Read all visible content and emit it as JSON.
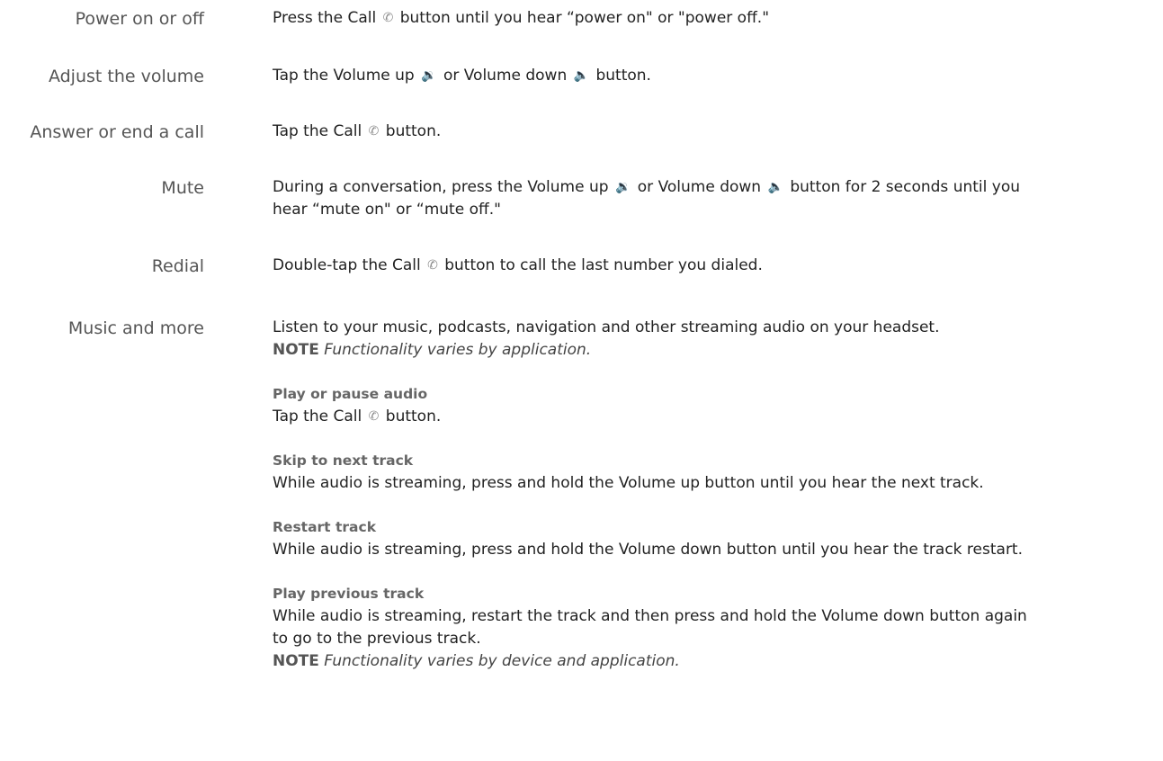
{
  "rows": {
    "power": {
      "label": "Power on or off",
      "pre": "Press the Call",
      "post": "button until you hear “power on\" or \"power off.\""
    },
    "volume": {
      "label": "Adjust the volume",
      "pre": "Tap the Volume up",
      "mid": "or Volume down",
      "post": "button."
    },
    "answer": {
      "label": "Answer or end a call",
      "pre": "Tap the Call",
      "post": "button."
    },
    "mute": {
      "label": "Mute",
      "pre": "During a conversation, press the Volume up",
      "mid": "or Volume down",
      "post": "button for 2 seconds until you",
      "line2": "hear “mute on\" or “mute off.\""
    },
    "redial": {
      "label": "Redial",
      "pre": "Double-tap the Call",
      "post": "button to call the last number you dialed."
    },
    "music": {
      "label": "Music and more",
      "intro": "Listen to your music, podcasts, navigation and other streaming audio on your headset.",
      "note_keyword": "NOTE",
      "note_text": "Functionality varies by application.",
      "play": {
        "heading": "Play or pause audio",
        "pre": "Tap the Call",
        "post": "button."
      },
      "skip": {
        "heading": "Skip to next track",
        "text": "While audio is streaming, press and hold the Volume up button until you hear the next track."
      },
      "restart": {
        "heading": "Restart track",
        "text": "While audio is streaming, press and hold the Volume down button until you hear the track restart."
      },
      "previous": {
        "heading": "Play previous track",
        "line1": "While audio is streaming, restart the track and then press and hold the Volume down button again",
        "line2": "to go to the previous track.",
        "note_keyword": "NOTE",
        "note_text": "Functionality varies by device and application."
      }
    }
  },
  "icons": {
    "call": "✆",
    "vol_up": "🔉",
    "vol_down": "🔈"
  }
}
